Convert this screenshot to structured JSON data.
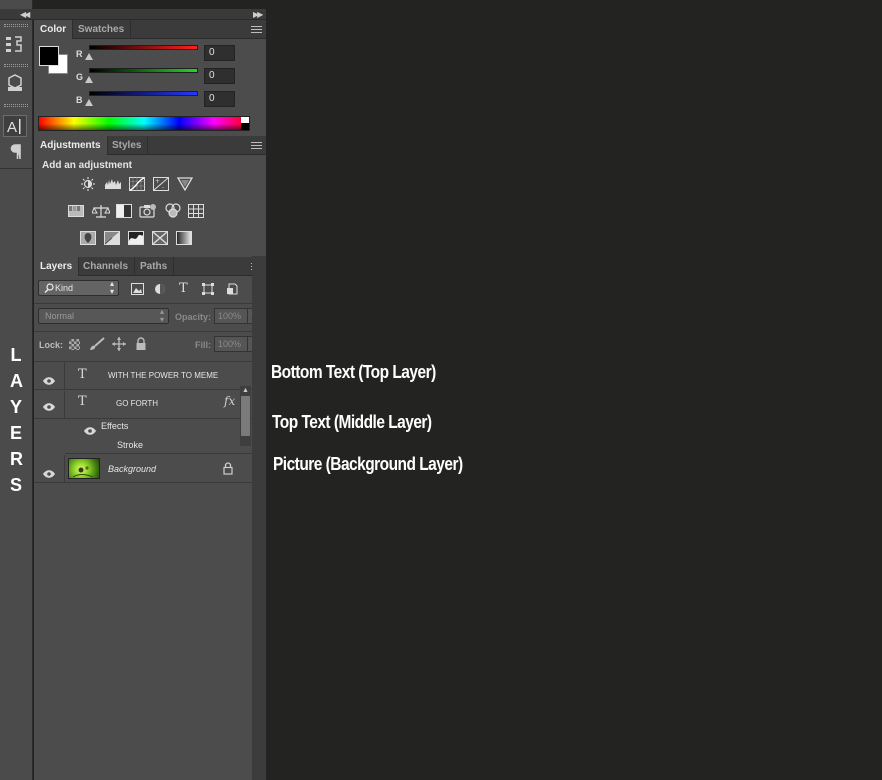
{
  "color_panel": {
    "tabs": [
      "Color",
      "Swatches"
    ],
    "channels": [
      {
        "label": "R",
        "value": "0",
        "color": "#ff2020"
      },
      {
        "label": "G",
        "value": "0",
        "color": "#26d42a"
      },
      {
        "label": "B",
        "value": "0",
        "color": "#2538ff"
      }
    ]
  },
  "adjustments_panel": {
    "tabs": [
      "Adjustments",
      "Styles"
    ],
    "heading": "Add an adjustment",
    "row1": [
      "brightness-contrast-icon",
      "levels-icon",
      "curves-icon",
      "exposure-icon",
      "vibrance-icon"
    ],
    "row2": [
      "hue-saturation-icon",
      "color-balance-icon",
      "black-white-icon",
      "photo-filter-icon",
      "channel-mixer-icon",
      "color-lookup-icon"
    ],
    "row3": [
      "invert-icon",
      "posterize-icon",
      "threshold-icon",
      "selective-color-icon",
      "gradient-map-icon"
    ]
  },
  "layers_panel": {
    "tabs": [
      "Layers",
      "Channels",
      "Paths"
    ],
    "filter_kind": "Kind",
    "blend_mode": "Normal",
    "opacity_label": "Opacity:",
    "opacity_value": "100%",
    "lock_label": "Lock:",
    "fill_label": "Fill:",
    "fill_value": "100%",
    "layers": [
      {
        "name": "WITH THE POWER TO MEME",
        "kind": "text"
      },
      {
        "name": "GO FORTH",
        "kind": "text",
        "fx": "fx",
        "effects_label": "Effects",
        "stroke_label": "Stroke"
      },
      {
        "name": "Background",
        "kind": "image"
      }
    ]
  },
  "annotations": {
    "vertical_word": [
      "L",
      "A",
      "Y",
      "E",
      "R",
      "S"
    ],
    "bottom_text": "Bottom Text (Top Layer)",
    "top_text": "Top Text (Middle Layer)",
    "picture": "Picture (Background Layer)"
  },
  "colors": {
    "panel_bg": "#4c4c4c",
    "canvas_bg": "#232422",
    "tab_bar": "#3b3b3b"
  }
}
